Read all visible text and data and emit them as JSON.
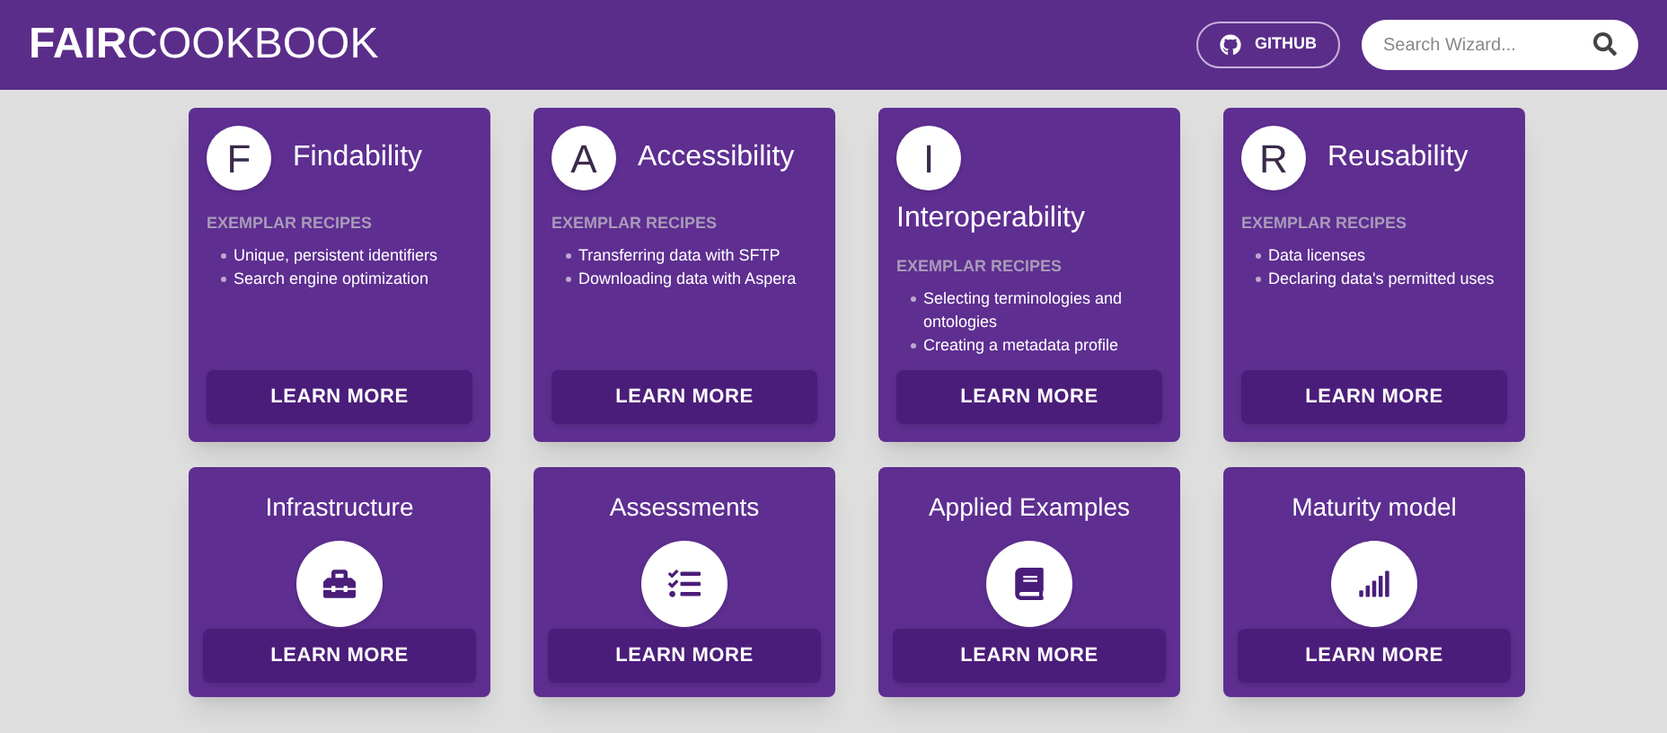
{
  "header": {
    "logo": {
      "bold": "FAIR",
      "rest": "COOKBOOK"
    },
    "github_button": "GITHUB",
    "search": {
      "placeholder": "Search Wizard..."
    }
  },
  "cards": [
    {
      "kind": "principle",
      "letter": "F",
      "title": "Findability",
      "section": "EXEMPLAR RECIPES",
      "recipes": [
        "Unique, persistent identifiers",
        "Search engine optimization"
      ],
      "button": "LEARN MORE"
    },
    {
      "kind": "principle",
      "letter": "A",
      "title": "Accessibility",
      "section": "EXEMPLAR RECIPES",
      "recipes": [
        "Transferring data with SFTP",
        "Downloading data with Aspera"
      ],
      "button": "LEARN MORE"
    },
    {
      "kind": "principle_stacked",
      "letter": "I",
      "title": "Interoperability",
      "section": "EXEMPLAR RECIPES",
      "recipes": [
        "Selecting terminologies and ontologies",
        "Creating a metadata profile"
      ],
      "button": "LEARN MORE"
    },
    {
      "kind": "principle",
      "letter": "R",
      "title": "Reusability",
      "section": "EXEMPLAR RECIPES",
      "recipes": [
        "Data licenses",
        "Declaring data's permitted uses"
      ],
      "button": "LEARN MORE"
    },
    {
      "kind": "topic",
      "title": "Infrastructure",
      "button": "LEARN MORE"
    },
    {
      "kind": "topic",
      "title": "Assessments",
      "button": "LEARN MORE"
    },
    {
      "kind": "topic",
      "title": "Applied Examples",
      "button": "LEARN MORE"
    },
    {
      "kind": "topic",
      "title": "Maturity model",
      "button": "LEARN MORE"
    }
  ]
}
